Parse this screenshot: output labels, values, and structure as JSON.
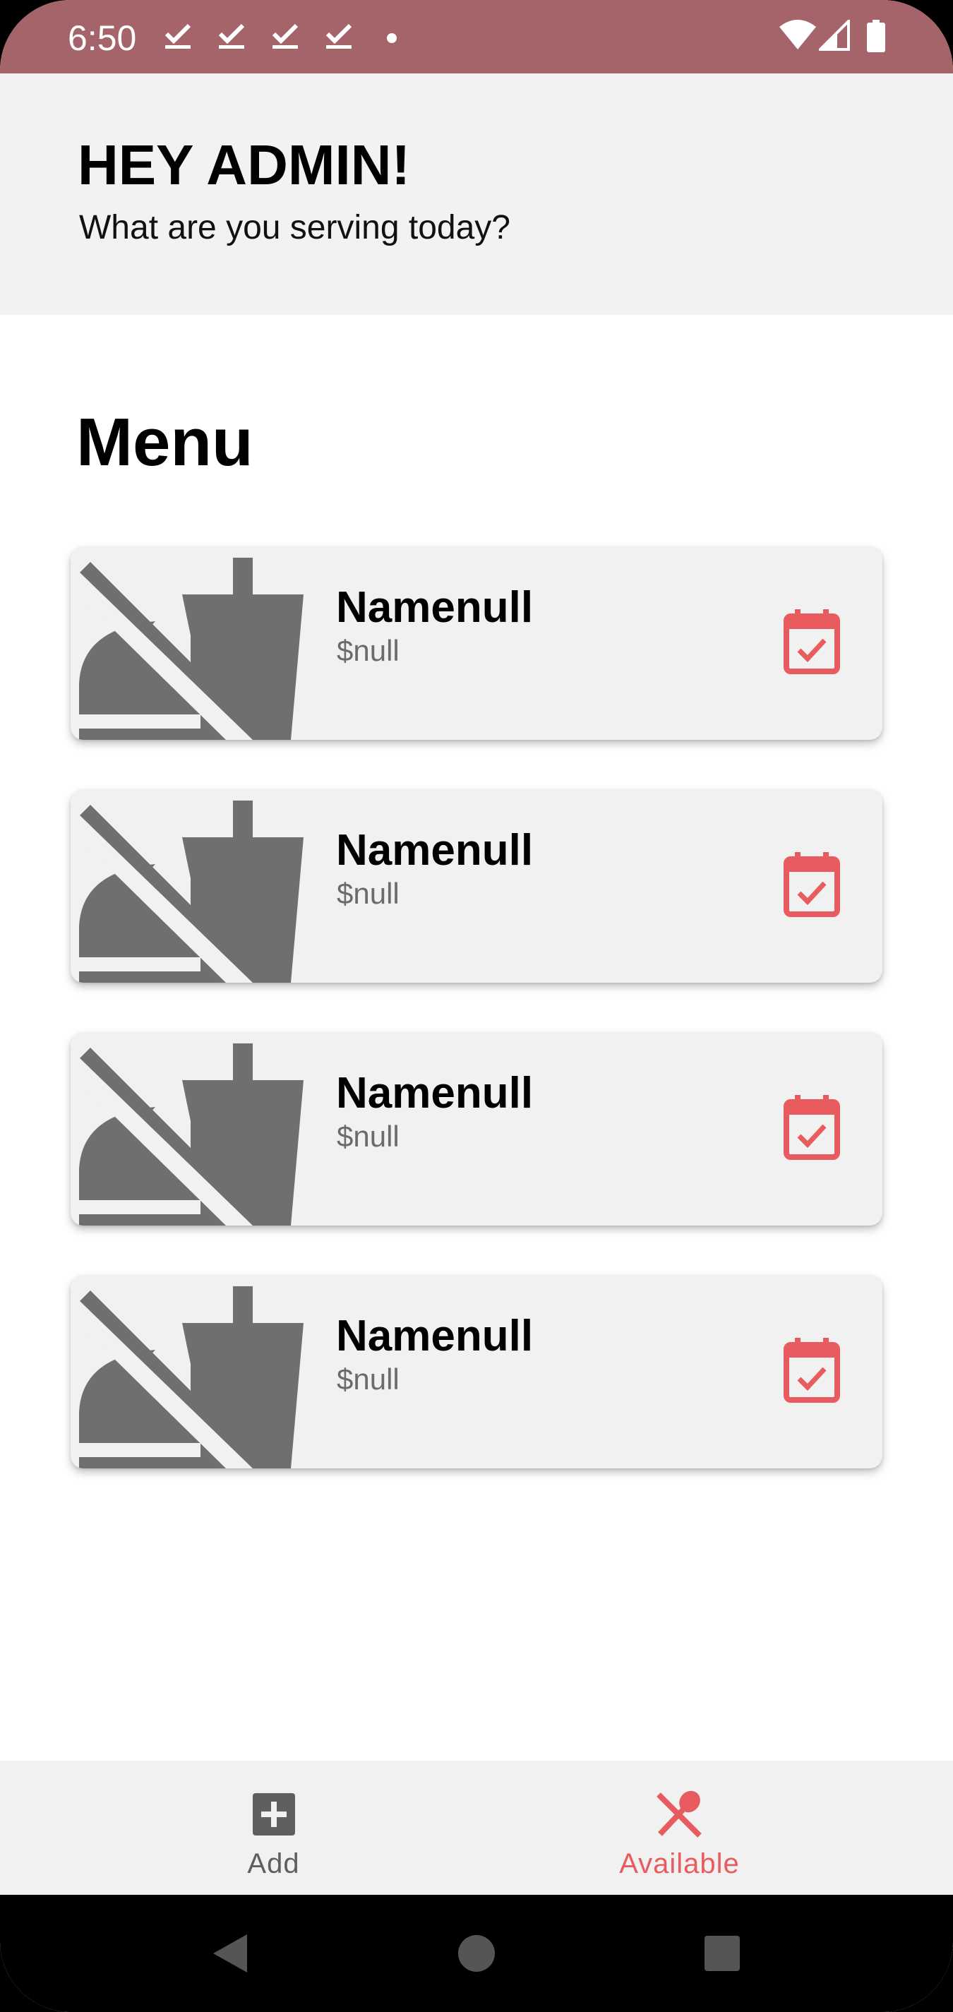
{
  "status_bar": {
    "time": "6:50",
    "notification_icons": [
      "checkmark-icon",
      "checkmark-icon",
      "checkmark-icon",
      "checkmark-icon"
    ],
    "system_icons": [
      "wifi-icon",
      "cell-signal-icon",
      "battery-icon"
    ]
  },
  "header": {
    "greeting": "HEY ADMIN!",
    "subtitle": "What are you serving today?"
  },
  "menu": {
    "title": "Menu",
    "items": [
      {
        "name": "Namenull",
        "price": "$null",
        "image_icon": "no-food-icon",
        "action_icon": "calendar-check-icon"
      },
      {
        "name": "Namenull",
        "price": "$null",
        "image_icon": "no-food-icon",
        "action_icon": "calendar-check-icon"
      },
      {
        "name": "Namenull",
        "price": "$null",
        "image_icon": "no-food-icon",
        "action_icon": "calendar-check-icon"
      },
      {
        "name": "Namenull",
        "price": "$null",
        "image_icon": "no-food-icon",
        "action_icon": "calendar-check-icon"
      }
    ]
  },
  "bottom_nav": {
    "items": [
      {
        "label": "Add",
        "icon": "add-box-icon",
        "active": false
      },
      {
        "label": "Available",
        "icon": "no-meals-icon",
        "active": true
      }
    ]
  },
  "colors": {
    "status_bar": "#a5636a",
    "header_bg": "#f2f2f2",
    "accent": "#e85c5f",
    "card_bg": "#f1f1f1",
    "icon_gray": "#6f6f6f"
  },
  "system_nav": {
    "buttons": [
      "back-icon",
      "home-icon",
      "recents-icon"
    ]
  }
}
